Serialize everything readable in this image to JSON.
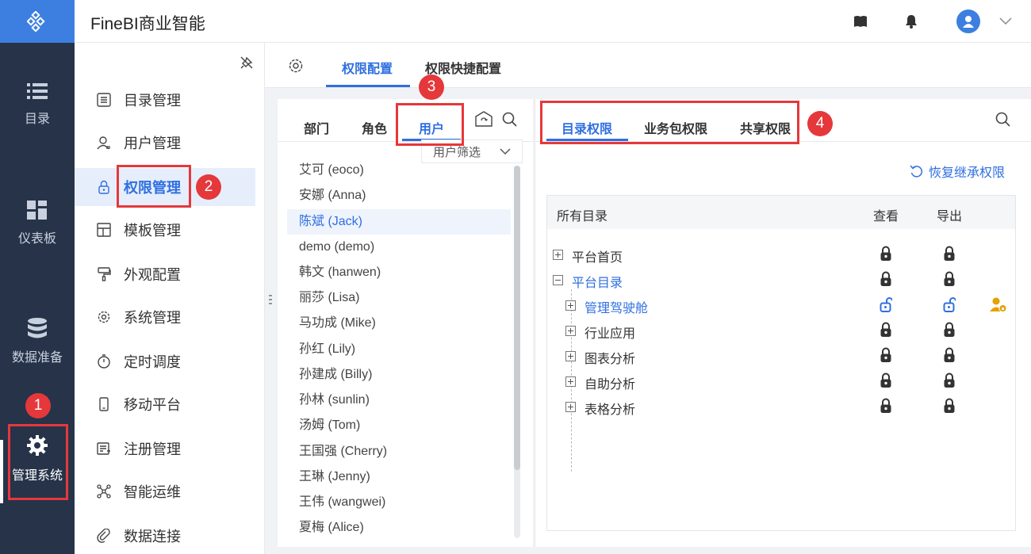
{
  "header": {
    "app_title": "FineBI商业智能"
  },
  "leftnav": {
    "items": [
      {
        "label": "目录"
      },
      {
        "label": "仪表板"
      },
      {
        "label": "数据准备"
      },
      {
        "label": "管理系统"
      }
    ]
  },
  "submenu": {
    "items": [
      {
        "label": "目录管理"
      },
      {
        "label": "用户管理"
      },
      {
        "label": "权限管理"
      },
      {
        "label": "模板管理"
      },
      {
        "label": "外观配置"
      },
      {
        "label": "系统管理"
      },
      {
        "label": "定时调度"
      },
      {
        "label": "移动平台"
      },
      {
        "label": "注册管理"
      },
      {
        "label": "智能运维"
      },
      {
        "label": "数据连接"
      }
    ]
  },
  "main": {
    "tabs": [
      {
        "label": "权限配置"
      },
      {
        "label": "权限快捷配置"
      }
    ],
    "left_panel": {
      "tabs": [
        {
          "label": "部门"
        },
        {
          "label": "角色"
        },
        {
          "label": "用户"
        }
      ],
      "filter_label": "用户筛选",
      "users": [
        "艾可 (eoco)",
        "安娜 (Anna)",
        "陈斌 (Jack)",
        "demo (demo)",
        "韩文 (hanwen)",
        "丽莎 (Lisa)",
        "马功成 (Mike)",
        "孙红 (Lily)",
        "孙建成 (Billy)",
        "孙林 (sunlin)",
        "汤姆 (Tom)",
        "王国强 (Cherry)",
        "王琳 (Jenny)",
        "王伟 (wangwei)",
        "夏梅 (Alice)"
      ]
    },
    "right_panel": {
      "tabs": [
        {
          "label": "目录权限"
        },
        {
          "label": "业务包权限"
        },
        {
          "label": "共享权限"
        }
      ],
      "restore_label": "恢复继承权限",
      "table": {
        "columns": [
          "所有目录",
          "查看",
          "导出"
        ],
        "rows": [
          {
            "label": "平台首页"
          },
          {
            "label": "平台目录"
          },
          {
            "label": "管理驾驶舱"
          },
          {
            "label": "行业应用"
          },
          {
            "label": "图表分析"
          },
          {
            "label": "自助分析"
          },
          {
            "label": "表格分析"
          }
        ]
      }
    }
  },
  "annotations": {
    "badges": [
      "1",
      "2",
      "3",
      "4"
    ]
  },
  "colors": {
    "accent": "#2f6fe0",
    "nav_bg": "#263349",
    "callout": "#e5383b"
  }
}
